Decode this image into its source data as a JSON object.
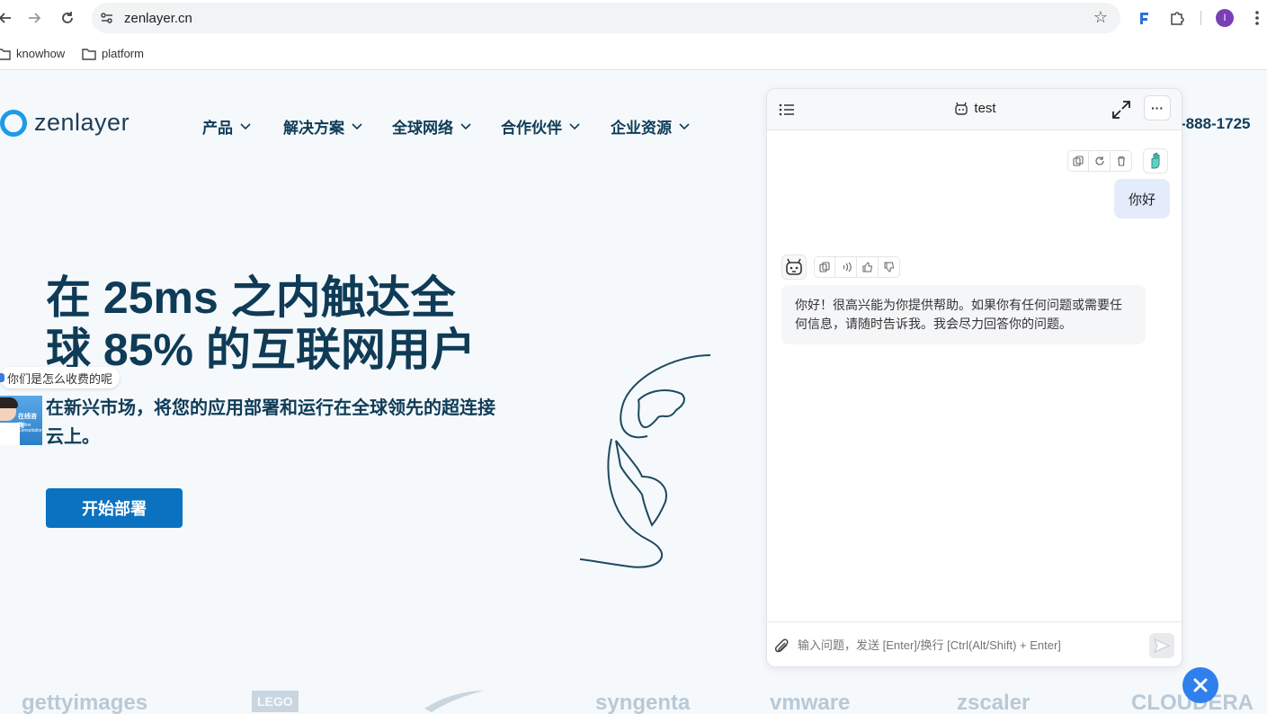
{
  "browser": {
    "url": "zenlayer.cn",
    "bookmarks": [
      "knowhow",
      "platform"
    ],
    "profile_initial": "I"
  },
  "site": {
    "logo_text": "zenlayer",
    "nav": [
      "产品",
      "解决方案",
      "全球网络",
      "合作伙伴",
      "企业资源"
    ],
    "phone": "-888-1725",
    "hero_title": "在 25ms 之内触达全球 85% 的互联网用户",
    "hero_subtitle": "在新兴市场，将您的应用部署和运行在全球领先的超连接云上。",
    "cta_label": "开始部署",
    "chat_bubble": "你们是怎么收费的呢",
    "agent_badge": "在线咨询",
    "agent_badge_en": "Online Consultation",
    "brand_logos": [
      "gettyimages",
      "LEGO",
      "syngenta",
      "vmware",
      "zscaler",
      "CLOUDERA"
    ]
  },
  "chat": {
    "title": "test",
    "user_message": "你好",
    "bot_message": "你好！很高兴能为你提供帮助。如果你有任何问题或需要任何信息，请随时告诉我。我会尽力回答你的问题。",
    "input_placeholder": "输入问题，发送 [Enter]/换行 [Ctrl(Alt/Shift) + Enter]",
    "more_label": "···"
  },
  "colors": {
    "brand_blue": "#0a72c0",
    "heading": "#0f3b56",
    "fab": "#2f80ed"
  }
}
